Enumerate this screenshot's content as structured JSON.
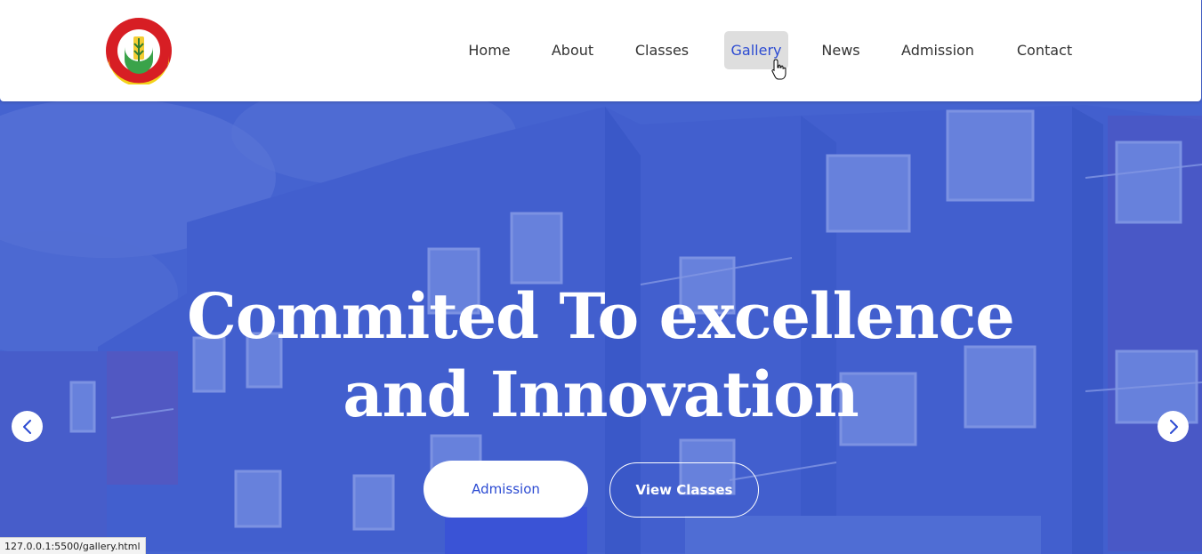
{
  "header": {
    "logo": {
      "icon": "school-crest-logo",
      "ring_text": "CEDAR BUDS SCHOOL",
      "motto": "Nurturing Your Child"
    },
    "nav": [
      {
        "label": "Home"
      },
      {
        "label": "About"
      },
      {
        "label": "Classes"
      },
      {
        "label": "Gallery",
        "active": true
      },
      {
        "label": "News"
      },
      {
        "label": "Admission"
      },
      {
        "label": "Contact"
      }
    ]
  },
  "hero": {
    "headline_line1": "Commited To excellence",
    "headline_line2": "and Innovation",
    "primary_button": "Admission",
    "secondary_button": "View Classes",
    "prev_icon": "chevron-left-icon",
    "next_icon": "chevron-right-icon",
    "overlay_color": "#3d5bd0"
  },
  "status_bar": {
    "url": "127.0.0.1:5500/gallery.html"
  },
  "colors": {
    "accent": "#2c4bd2",
    "nav_active_bg": "#dedede",
    "nav_text": "#333333"
  }
}
